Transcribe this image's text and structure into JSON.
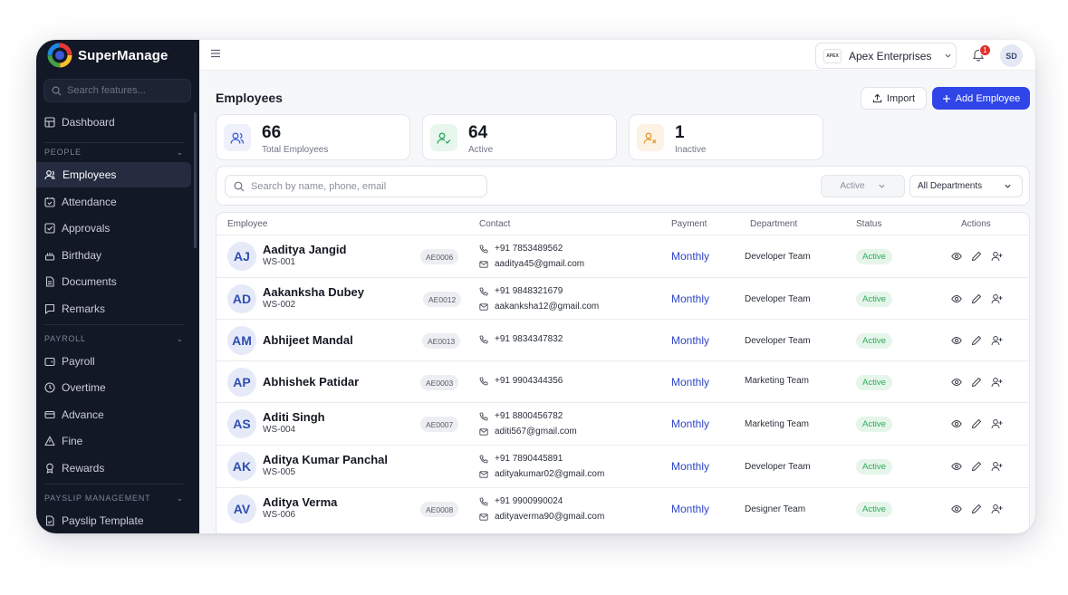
{
  "app": {
    "brand_name": "SuperManage"
  },
  "sidebar": {
    "search_placeholder": "Search features...",
    "dashboard": "Dashboard",
    "sections": [
      {
        "label": "PEOPLE"
      },
      {
        "label": "PAYROLL"
      },
      {
        "label": "PAYSLIP MANAGEMENT"
      }
    ],
    "people_items": [
      {
        "label": "Employees",
        "icon": "users-icon"
      },
      {
        "label": "Attendance",
        "icon": "calendar-check-icon"
      },
      {
        "label": "Approvals",
        "icon": "approvals-icon"
      },
      {
        "label": "Birthday",
        "icon": "cake-icon"
      },
      {
        "label": "Documents",
        "icon": "document-icon"
      },
      {
        "label": "Remarks",
        "icon": "chat-icon"
      }
    ],
    "payroll_items": [
      {
        "label": "Payroll",
        "icon": "wallet-icon"
      },
      {
        "label": "Overtime",
        "icon": "clock-icon"
      },
      {
        "label": "Advance",
        "icon": "card-icon"
      },
      {
        "label": "Fine",
        "icon": "warning-icon"
      },
      {
        "label": "Rewards",
        "icon": "award-icon"
      }
    ],
    "payslip_items": [
      {
        "label": "Payslip Template",
        "icon": "template-icon"
      }
    ],
    "active_item": "Employees"
  },
  "topbar": {
    "company_name": "Apex Enterprises",
    "company_logo_text": "APEX",
    "notification_count": "1",
    "user_initials": "SD"
  },
  "page": {
    "title": "Employees",
    "import_label": "Import",
    "add_label": "Add Employee"
  },
  "stats": [
    {
      "value": "66",
      "label": "Total Employees",
      "color": "#3b5bdb",
      "bg": "#eef1fc"
    },
    {
      "value": "64",
      "label": "Active",
      "color": "#2eaa5a",
      "bg": "#e8f6ed"
    },
    {
      "value": "1",
      "label": "Inactive",
      "color": "#e59a2f",
      "bg": "#fdf3e4"
    }
  ],
  "filters": {
    "search_placeholder": "Search by name, phone, email",
    "status_value": "Active",
    "department_value": "All Departments"
  },
  "table": {
    "headers": {
      "employee": "Employee",
      "contact": "Contact",
      "payment": "Payment",
      "department": "Department",
      "status": "Status",
      "actions": "Actions"
    },
    "rows": [
      {
        "initials": "AJ",
        "name": "Aaditya Jangid",
        "code": "WS-001",
        "emp_id": "AE0006",
        "phone": "+91 7853489562",
        "email": "aaditya45@gmail.com",
        "payment": "Monthly",
        "department": "Developer Team",
        "status": "Active"
      },
      {
        "initials": "AD",
        "name": "Aakanksha Dubey",
        "code": "WS-002",
        "emp_id": "AE0012",
        "phone": "+91 9848321679",
        "email": "aakanksha12@gmail.com",
        "payment": "Monthly",
        "department": "Developer Team",
        "status": "Active"
      },
      {
        "initials": "AM",
        "name": "Abhijeet Mandal",
        "code": "",
        "emp_id": "AE0013",
        "phone": "+91 9834347832",
        "email": "",
        "payment": "Monthly",
        "department": "Developer Team",
        "status": "Active"
      },
      {
        "initials": "AP",
        "name": "Abhishek Patidar",
        "code": "",
        "emp_id": "AE0003",
        "phone": "+91 9904344356",
        "email": "",
        "payment": "Monthly",
        "department": "Marketing Team",
        "status": "Active"
      },
      {
        "initials": "AS",
        "name": "Aditi Singh",
        "code": "WS-004",
        "emp_id": "AE0007",
        "phone": "+91 8800456782",
        "email": "aditi567@gmail.com",
        "payment": "Monthly",
        "department": "Marketing Team",
        "status": "Active"
      },
      {
        "initials": "AK",
        "name": "Aditya Kumar Panchal",
        "code": "WS-005",
        "emp_id": "",
        "phone": "+91 7890445891",
        "email": "adityakumar02@gmail.com",
        "payment": "Monthly",
        "department": "Developer Team",
        "status": "Active"
      },
      {
        "initials": "AV",
        "name": "Aditya Verma",
        "code": "WS-006",
        "emp_id": "AE0008",
        "phone": "+91 9900990024",
        "email": "adityaverma90@gmail.com",
        "payment": "Monthly",
        "department": "Designer Team",
        "status": "Active"
      }
    ]
  }
}
